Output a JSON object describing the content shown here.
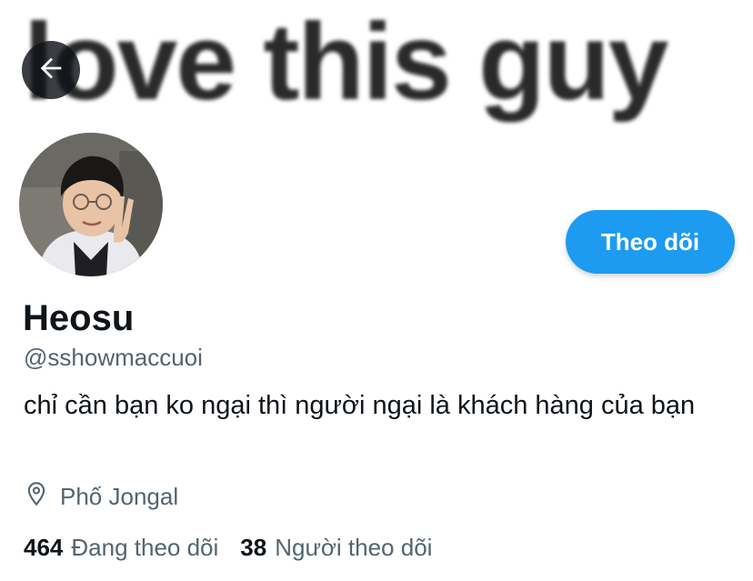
{
  "banner": {
    "text": "love this guy"
  },
  "header": {
    "back_icon": "arrow-left-icon"
  },
  "profile": {
    "name": "Heosu",
    "handle": "@sshowmaccuoi",
    "bio": "chỉ cần bạn ko ngại thì người ngại là khách hàng của bạn",
    "location": "Phố Jongal",
    "location_icon": "location-pin-icon"
  },
  "actions": {
    "follow_label": "Theo dõi"
  },
  "stats": {
    "following_count": "464",
    "following_label": "Đang theo dõi",
    "followers_count": "38",
    "followers_label": "Người theo dõi"
  },
  "colors": {
    "accent": "#1d9bf0",
    "secondary_text": "#536471",
    "primary_text": "#0f1419"
  }
}
